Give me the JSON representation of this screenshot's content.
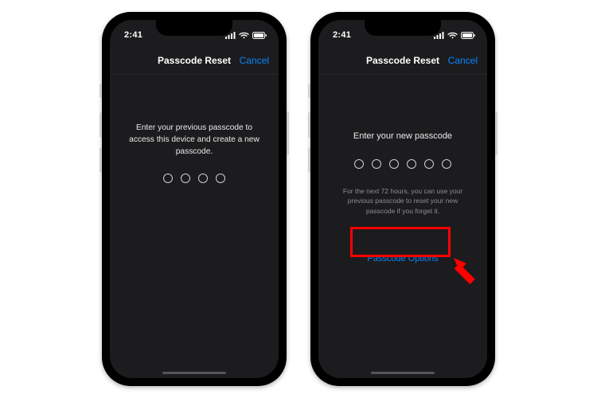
{
  "status": {
    "time": "2:41"
  },
  "nav": {
    "title": "Passcode Reset",
    "cancel": "Cancel"
  },
  "left": {
    "instruction": "Enter your previous passcode to access this device and create a new passcode.",
    "dot_count": 4
  },
  "right": {
    "instruction": "Enter your new passcode",
    "dot_count": 6,
    "subnote": "For the next 72 hours, you can use your previous passcode to reset your new passcode if you forget it.",
    "options": "Passcode Options"
  }
}
